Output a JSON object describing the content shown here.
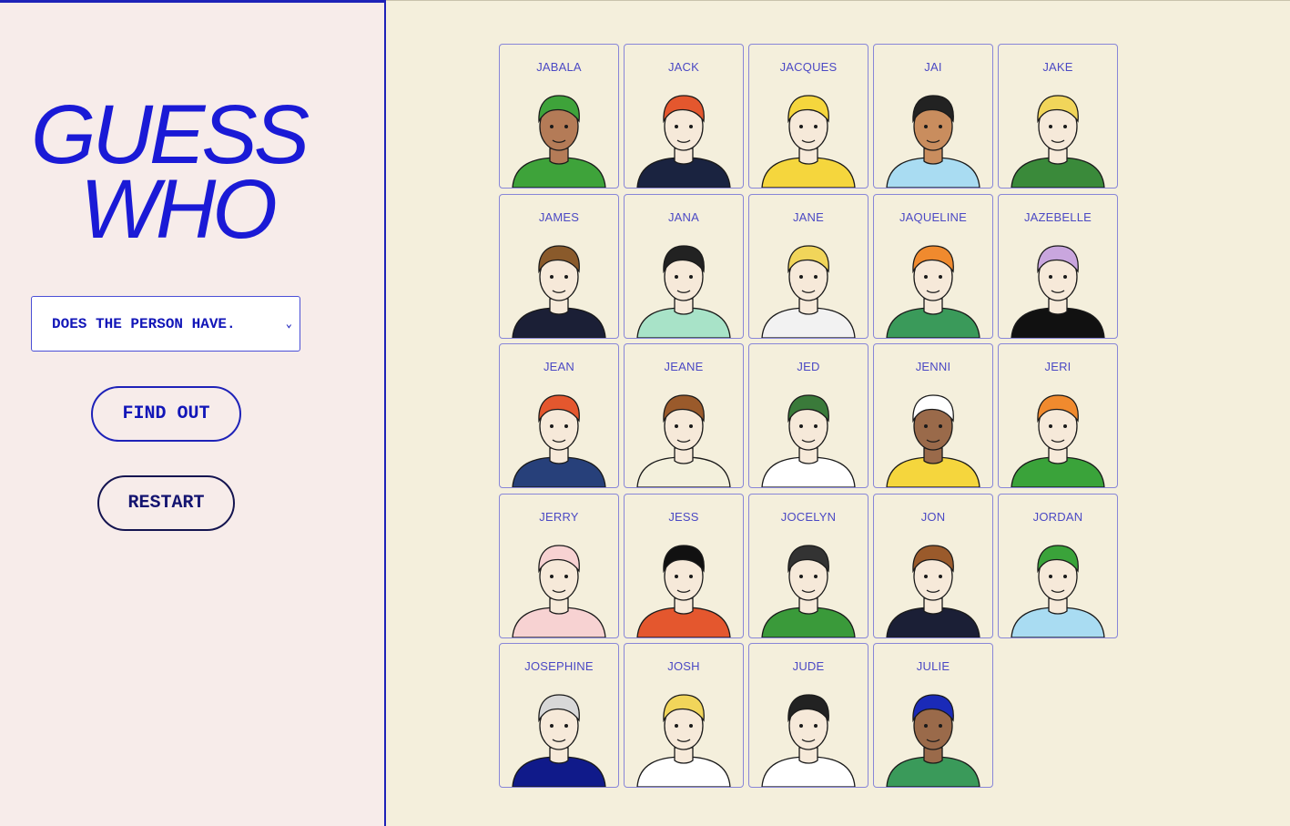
{
  "title": {
    "line1": "GUESS",
    "line2": "WHO"
  },
  "question_select": {
    "value": "DOES THE PERSON HAVE."
  },
  "buttons": {
    "find_out": "FIND OUT",
    "restart": "RESTART"
  },
  "colors": {
    "accent": "#1a1ad6",
    "sidebar_bg": "#f7ecea",
    "board_bg": "#f4efdc",
    "card_border": "#8886d8"
  },
  "characters": [
    {
      "name": "JABALA",
      "shirt": "#3ea33a",
      "hair": "#3ea33a",
      "skin": "#b47b57",
      "icon": "jabala-portrait-icon"
    },
    {
      "name": "JACK",
      "shirt": "#1a2340",
      "hair": "#e4572e",
      "skin": "#f6e9d9",
      "icon": "jack-portrait-icon"
    },
    {
      "name": "JACQUES",
      "shirt": "#f5d63d",
      "hair": "#f5d63d",
      "skin": "#f6e9d9",
      "icon": "jacques-portrait-icon"
    },
    {
      "name": "JAI",
      "shirt": "#a9dcf2",
      "hair": "#222222",
      "skin": "#c98d5e",
      "icon": "jai-portrait-icon"
    },
    {
      "name": "JAKE",
      "shirt": "#3a8a3a",
      "hair": "#f1d55a",
      "skin": "#f6e9d9",
      "icon": "jake-portrait-icon"
    },
    {
      "name": "JAMES",
      "shirt": "#1b1f36",
      "hair": "#8a5a2b",
      "skin": "#f6e9d9",
      "icon": "james-portrait-icon"
    },
    {
      "name": "JANA",
      "shirt": "#a8e3c8",
      "hair": "#222222",
      "skin": "#f6e9d9",
      "icon": "jana-portrait-icon"
    },
    {
      "name": "JANE",
      "shirt": "#f2f2f2",
      "hair": "#f1d55a",
      "skin": "#f6e9d9",
      "icon": "jane-portrait-icon"
    },
    {
      "name": "JAQUELINE",
      "shirt": "#3a9a5a",
      "hair": "#f08a2e",
      "skin": "#f6e9d9",
      "icon": "jaqueline-portrait-icon"
    },
    {
      "name": "JAZEBELLE",
      "shirt": "#111111",
      "hair": "#c9a6de",
      "skin": "#f6e9d9",
      "icon": "jazebelle-portrait-icon"
    },
    {
      "name": "JEAN",
      "shirt": "#27407a",
      "hair": "#e4572e",
      "skin": "#f6e9d9",
      "icon": "jean-portrait-icon"
    },
    {
      "name": "JEANE",
      "shirt": "#f3f0dc",
      "hair": "#9a5a2b",
      "skin": "#f6e9d9",
      "icon": "jeane-portrait-icon"
    },
    {
      "name": "JED",
      "shirt": "#ffffff",
      "hair": "#3a7a3a",
      "skin": "#f6e9d9",
      "icon": "jed-portrait-icon"
    },
    {
      "name": "JENNI",
      "shirt": "#f5d63d",
      "hair": "#ffffff",
      "skin": "#9a6a4a",
      "icon": "jenni-portrait-icon"
    },
    {
      "name": "JERI",
      "shirt": "#3aa33a",
      "hair": "#f08a2e",
      "skin": "#f6e9d9",
      "icon": "jeri-portrait-icon"
    },
    {
      "name": "JERRY",
      "shirt": "#f7d2d2",
      "hair": "#f7d2d2",
      "skin": "#f6e9d9",
      "icon": "jerry-portrait-icon"
    },
    {
      "name": "JESS",
      "shirt": "#e4572e",
      "hair": "#111111",
      "skin": "#f6e9d9",
      "icon": "jess-portrait-icon"
    },
    {
      "name": "JOCELYN",
      "shirt": "#3a9a3a",
      "hair": "#333333",
      "skin": "#f6e9d9",
      "icon": "jocelyn-portrait-icon"
    },
    {
      "name": "JON",
      "shirt": "#1b1f36",
      "hair": "#9a5a2b",
      "skin": "#f6e9d9",
      "icon": "jon-portrait-icon"
    },
    {
      "name": "JORDAN",
      "shirt": "#a9dcf2",
      "hair": "#3aa33a",
      "skin": "#f6e9d9",
      "icon": "jordan-portrait-icon"
    },
    {
      "name": "JOSEPHINE",
      "shirt": "#101a8a",
      "hair": "#d8d8d8",
      "skin": "#f6e9d9",
      "icon": "josephine-portrait-icon"
    },
    {
      "name": "JOSH",
      "shirt": "#ffffff",
      "hair": "#f1d55a",
      "skin": "#f6e9d9",
      "icon": "josh-portrait-icon"
    },
    {
      "name": "JUDE",
      "shirt": "#ffffff",
      "hair": "#222222",
      "skin": "#f6e9d9",
      "icon": "jude-portrait-icon"
    },
    {
      "name": "JULIE",
      "shirt": "#3a9a5a",
      "hair": "#1a2ab8",
      "skin": "#9a6a4a",
      "icon": "julie-portrait-icon"
    }
  ]
}
